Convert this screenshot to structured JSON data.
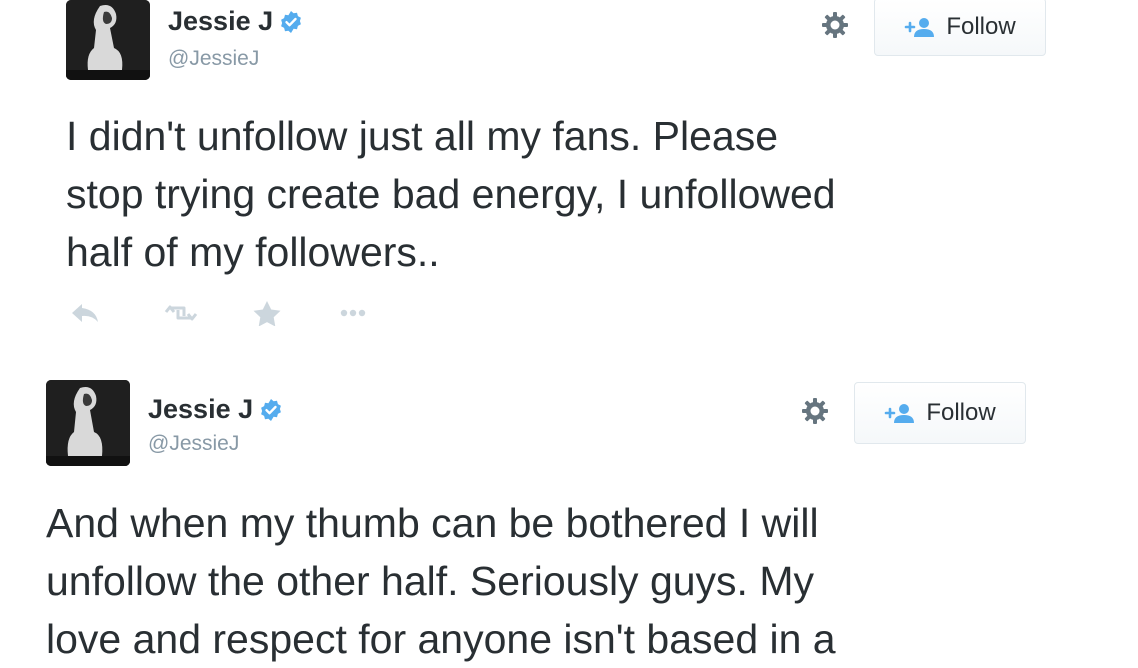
{
  "tweets": [
    {
      "display_name": "Jessie J",
      "handle": "@JessieJ",
      "follow_label": "Follow",
      "text_lines": [
        "I didn't unfollow just all my fans. Please",
        "stop trying create bad energy, I unfollowed",
        "half of my followers.."
      ]
    },
    {
      "display_name": "Jessie J",
      "handle": "@JessieJ",
      "follow_label": "Follow",
      "text_lines": [
        "And when my thumb can be bothered I will",
        "unfollow the other half. Seriously guys. My",
        "love and respect for anyone isn't based in a"
      ]
    }
  ],
  "icons": {
    "verified": "verified-badge-icon",
    "gear": "gear-icon",
    "follow": "add-user-icon",
    "reply": "reply-icon",
    "retweet": "retweet-icon",
    "favorite": "star-icon",
    "more": "more-icon"
  },
  "colors": {
    "verified_blue": "#55acee",
    "text": "#292f33",
    "muted": "#8899a6",
    "action_grey": "#ccd6dd",
    "follow_icon_blue": "#55acee"
  }
}
